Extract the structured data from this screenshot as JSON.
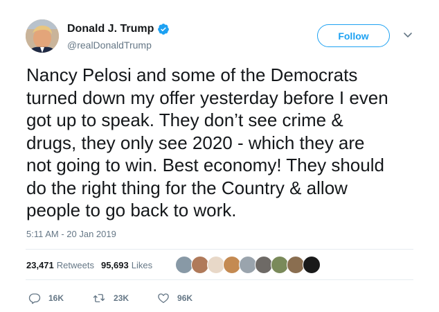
{
  "author": {
    "display_name": "Donald J. Trump",
    "handle": "@realDonaldTrump",
    "verified": true,
    "avatar_icon": "profile-photo"
  },
  "follow_button": {
    "label": "Follow"
  },
  "menu_icon": "chevron-down-icon",
  "tweet": {
    "lines": [
      "Nancy Pelosi and some of the Democrats",
      "turned down my offer yesterday before I even",
      "got up to speak. They don’t see crime &",
      "drugs, they only see 2020 - which they are",
      "not going to win. Best economy! They should",
      "do the right thing for the Country & allow",
      "people to go back to work."
    ],
    "timestamp": "5:11 AM - 20 Jan 2019"
  },
  "stats": {
    "retweets_count": "23,471",
    "retweets_label": "Retweets",
    "likes_count": "95,693",
    "likes_label": "Likes"
  },
  "likers": [
    {
      "color": "#8899a6"
    },
    {
      "color": "#b07a5a"
    },
    {
      "color": "#e8d8c8"
    },
    {
      "color": "#c48a52"
    },
    {
      "color": "#9aa4ad"
    },
    {
      "color": "#6e6a66"
    },
    {
      "color": "#7a8a5a"
    },
    {
      "color": "#8a6e50"
    },
    {
      "color": "#1a1a1a"
    }
  ],
  "actions": {
    "replies": "16K",
    "retweets": "23K",
    "likes": "96K"
  },
  "colors": {
    "accent": "#1da1f2",
    "secondary_text": "#657786",
    "divider": "#e6ecf0"
  }
}
